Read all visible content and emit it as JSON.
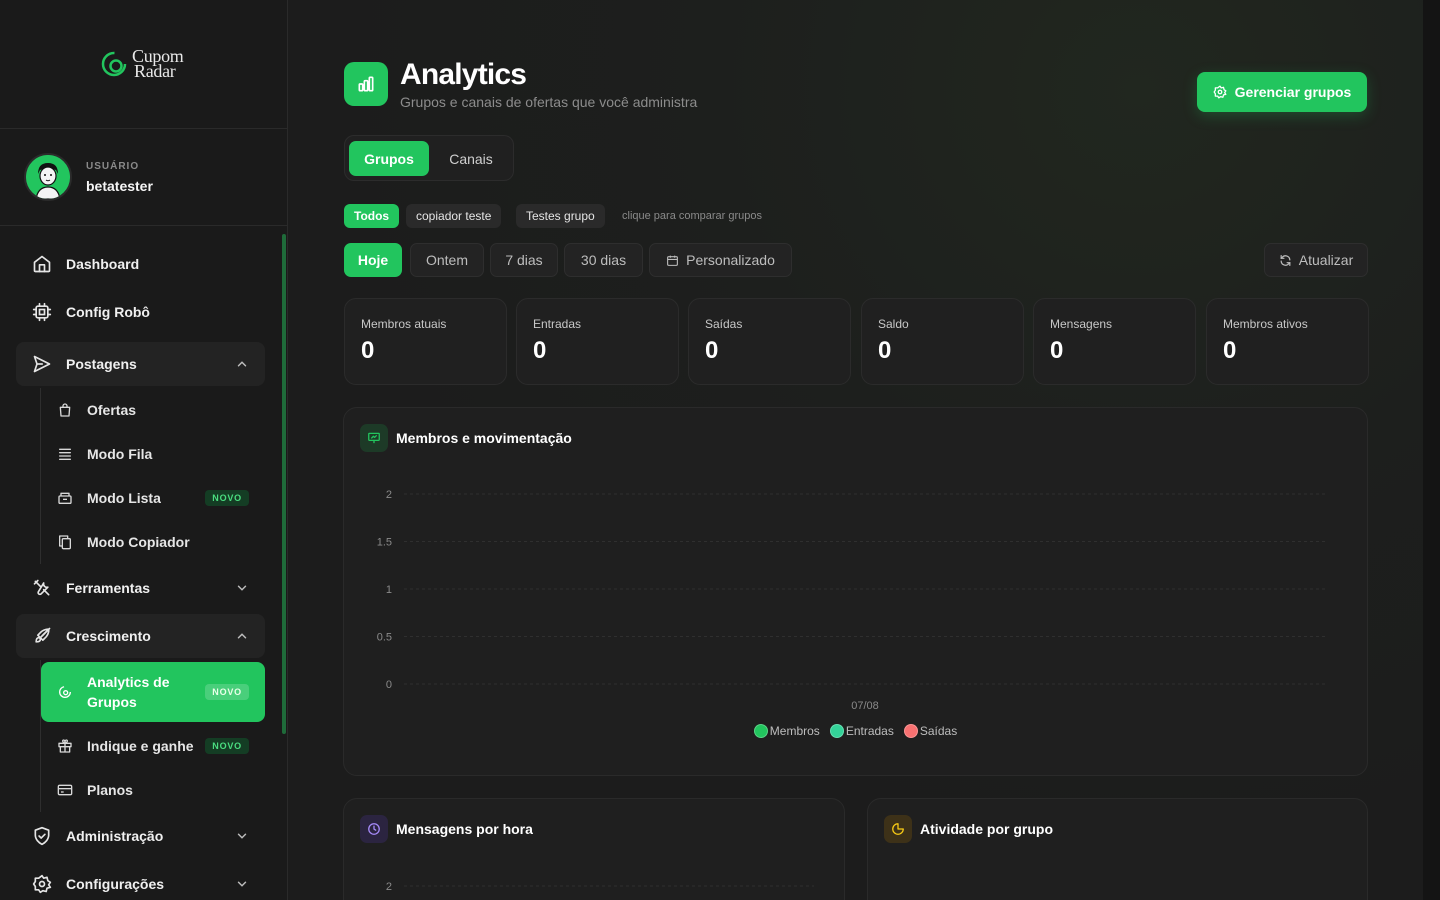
{
  "brand": {
    "line1": "Cupom",
    "line2": "Radar"
  },
  "user": {
    "role": "USUÁRIO",
    "name": "betatester"
  },
  "nav": {
    "dashboard": "Dashboard",
    "config_robo": "Config Robô",
    "postagens": "Postagens",
    "postagens_items": {
      "ofertas": "Ofertas",
      "modo_fila": "Modo Fila",
      "modo_lista": "Modo Lista",
      "modo_copiador": "Modo Copiador"
    },
    "ferramentas": "Ferramentas",
    "crescimento": "Crescimento",
    "crescimento_items": {
      "analytics": "Analytics de Grupos",
      "indique": "Indique e ganhe",
      "planos": "Planos"
    },
    "administracao": "Administração",
    "configuracoes": "Configurações",
    "badge_new": "NOVO"
  },
  "header": {
    "title": "Analytics",
    "subtitle": "Grupos e canais de ofertas que você administra",
    "manage_button": "Gerenciar grupos"
  },
  "tabs": {
    "groups": "Grupos",
    "channels": "Canais",
    "active": "Grupos"
  },
  "group_filter": {
    "chips": [
      "Todos",
      "copiador teste",
      "Testes grupo"
    ],
    "active": "Todos",
    "hint": "clique para comparar grupos"
  },
  "periods": {
    "items": [
      "Hoje",
      "Ontem",
      "7 dias",
      "30 dias",
      "Personalizado"
    ],
    "active": "Hoje",
    "refresh": "Atualizar"
  },
  "stats": [
    {
      "label": "Membros atuais",
      "value": "0"
    },
    {
      "label": "Entradas",
      "value": "0"
    },
    {
      "label": "Saídas",
      "value": "0"
    },
    {
      "label": "Saldo",
      "value": "0"
    },
    {
      "label": "Mensagens",
      "value": "0"
    },
    {
      "label": "Membros ativos",
      "value": "0"
    }
  ],
  "members_panel": {
    "title": "Membros e movimentação"
  },
  "messages_panel": {
    "title": "Mensagens por hora"
  },
  "activity_panel": {
    "title": "Atividade por grupo"
  },
  "colors": {
    "accent": "#22c55e",
    "membros": "#22c55e",
    "entradas": "#34d399",
    "saidas": "#f87171"
  },
  "chart_data": [
    {
      "type": "line",
      "title": "Membros e movimentação",
      "x": [
        "07/08"
      ],
      "series": [
        {
          "name": "Membros",
          "values": [
            0
          ]
        },
        {
          "name": "Entradas",
          "values": [
            0
          ]
        },
        {
          "name": "Saídas",
          "values": [
            0
          ]
        }
      ],
      "yticks": [
        "0",
        "0.5",
        "1",
        "1.5",
        "2"
      ],
      "ylim": [
        0,
        2
      ],
      "grid": true,
      "legend": "bottom"
    },
    {
      "type": "bar",
      "title": "Mensagens por hora",
      "yticks_visible": [
        "2"
      ],
      "grid": true
    }
  ]
}
